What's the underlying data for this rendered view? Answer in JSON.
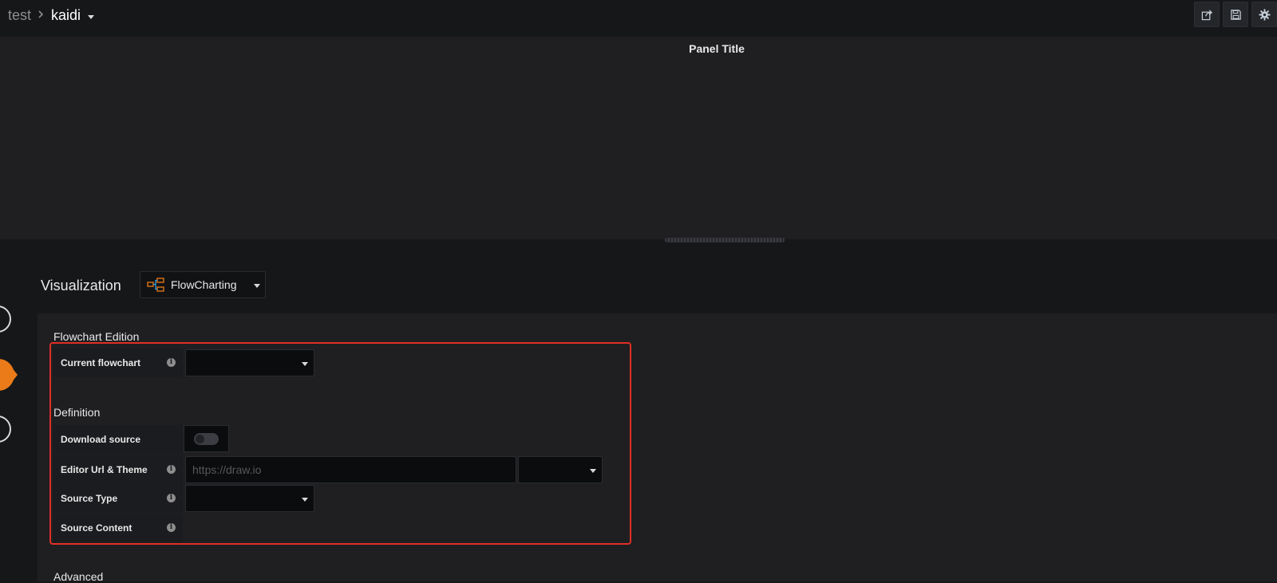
{
  "breadcrumb": {
    "parent": "test",
    "current": "kaidi"
  },
  "toolbar": {
    "share_icon": "share-icon",
    "save_icon": "save-icon",
    "settings_icon": "gear-icon"
  },
  "panel": {
    "title": "Panel Title"
  },
  "editor": {
    "visualization_label": "Visualization",
    "visualization_value": "FlowCharting",
    "flowchart_edition_title": "Flowchart Edition",
    "current_flowchart_label": "Current flowchart",
    "current_flowchart_value": "",
    "definition_title": "Definition",
    "download_source_label": "Download source",
    "download_source_enabled": false,
    "editor_url_label": "Editor Url & Theme",
    "editor_url_placeholder": "https://draw.io",
    "editor_url_value": "",
    "editor_theme_value": "",
    "source_type_label": "Source Type",
    "source_type_value": "",
    "source_content_label": "Source Content",
    "advanced_title": "Advanced"
  },
  "colors": {
    "accent": "#eb7b18",
    "highlight": "#e02f25",
    "background": "#161719",
    "panel": "#1f1f22"
  }
}
